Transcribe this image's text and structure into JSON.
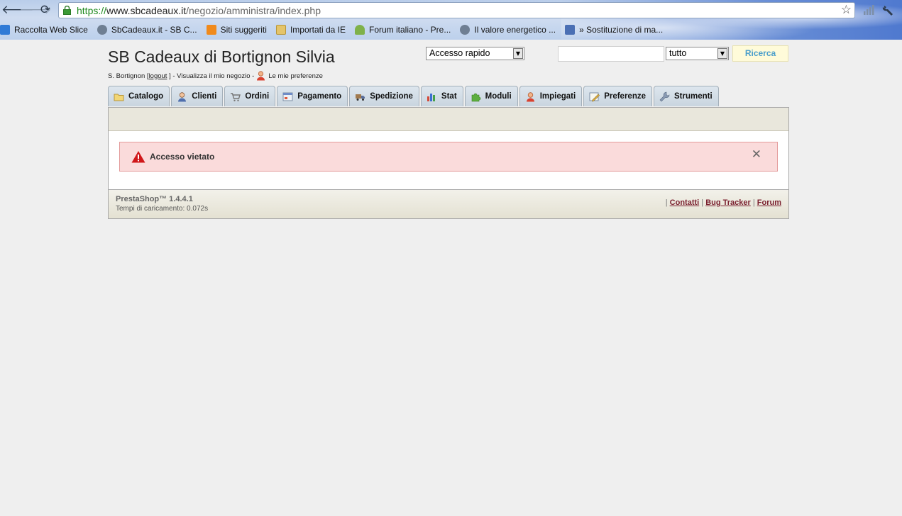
{
  "browser": {
    "url": {
      "scheme": "https://",
      "host": "www.sbcadeaux.it",
      "path": "/negozio/amministra/index.php"
    },
    "bookmarks": [
      {
        "label": "Raccolta Web Slice",
        "icon": "ie-icon",
        "color": "#2f7ad6"
      },
      {
        "label": "SbCadeaux.it - SB C...",
        "icon": "globe-icon",
        "color": "#6f7f93"
      },
      {
        "label": "Siti suggeriti",
        "icon": "lightbulb-icon",
        "color": "#f08a1c"
      },
      {
        "label": "Importati da IE",
        "icon": "folder-icon",
        "color": "#e4c46a"
      },
      {
        "label": "Forum italiano - Pre...",
        "icon": "prestashop-icon",
        "color": "#7fb14a"
      },
      {
        "label": "Il valore energetico ...",
        "icon": "globe-icon",
        "color": "#6f7f93"
      },
      {
        "label": "» Sostituzione di ma...",
        "icon": "site-icon",
        "color": "#4a6fb4"
      }
    ]
  },
  "header": {
    "shop_title": "SB Cadeaux di Bortignon Silvia",
    "user": {
      "name_prefix": "S. Bortignon [",
      "logout": "logout",
      "middle": "] - Visualizza il mio negozio -",
      "preferences": "Le mie preferenze"
    },
    "quick_access": {
      "selected": "Accesso rapido"
    },
    "search": {
      "value": "",
      "scope": "tutto",
      "button": "Ricerca"
    }
  },
  "tabs": [
    {
      "label": "Catalogo",
      "icon": "folder-icon"
    },
    {
      "label": "Clienti",
      "icon": "customer-icon"
    },
    {
      "label": "Ordini",
      "icon": "cart-icon"
    },
    {
      "label": "Pagamento",
      "icon": "payment-icon"
    },
    {
      "label": "Spedizione",
      "icon": "truck-icon"
    },
    {
      "label": "Stat",
      "icon": "chart-icon"
    },
    {
      "label": "Moduli",
      "icon": "puzzle-icon"
    },
    {
      "label": "Impiegati",
      "icon": "employee-icon"
    },
    {
      "label": "Preferenze",
      "icon": "preferences-icon"
    },
    {
      "label": "Strumenti",
      "icon": "wrench-icon"
    }
  ],
  "alert": {
    "message": "Accesso vietato"
  },
  "footer": {
    "version": "PrestaShop™ 1.4.4.1",
    "load_time": "Tempi di caricamento: 0.072s",
    "links": {
      "contact": "Contatti",
      "bug_tracker": "Bug Tracker",
      "forum": "Forum"
    }
  },
  "colors": {
    "accent": "#4a9ecb",
    "link": "#7a1f2e",
    "alert_bg": "#fadbdb"
  }
}
